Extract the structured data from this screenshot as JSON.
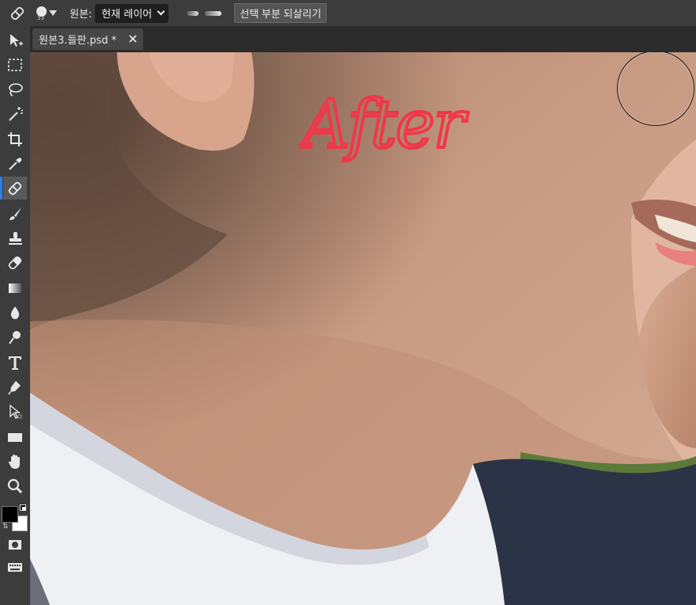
{
  "options_bar": {
    "tool_icon": "healing-brush-icon",
    "brush_size": "33",
    "source_label": "원본:",
    "source_value": "현재 레이어",
    "restore_button": "선택 부분 되살리기"
  },
  "tabs": [
    {
      "label": "원본3.들판.psd *",
      "close_icon": "close-icon"
    }
  ],
  "toolbar": {
    "active_tool": "healing-brush",
    "tools": [
      "move-icon",
      "marquee-icon",
      "lasso-icon",
      "magic-wand-icon",
      "crop-icon",
      "eyedropper-icon",
      "healing-brush-icon",
      "brush-icon",
      "clone-stamp-icon",
      "eraser-icon",
      "gradient-icon",
      "blur-icon",
      "dodge-icon",
      "text-icon",
      "pen-icon",
      "direct-select-icon",
      "rectangle-icon",
      "hand-icon",
      "zoom-icon",
      "quick-mask-icon",
      "keyboard-icon"
    ],
    "foreground_color": "#000000",
    "background_color": "#ffffff"
  },
  "canvas": {
    "annotation": "After",
    "annotation_color": "#ef3848"
  }
}
